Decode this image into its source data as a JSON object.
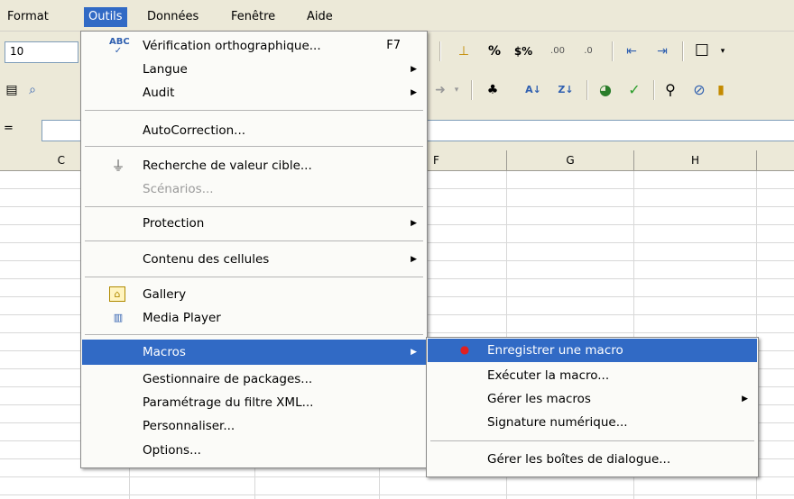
{
  "menubar": {
    "items": [
      {
        "label": "Format"
      },
      {
        "label": "Outils"
      },
      {
        "label": "Données"
      },
      {
        "label": "Fenêtre"
      },
      {
        "label": "Aide"
      }
    ]
  },
  "toolbar": {
    "font_size": "10",
    "formula_prefix": "=",
    "icons": [
      "spellcheck-icon",
      "preview-icon",
      "number-format-icon",
      "percent-icon",
      "currency-icon",
      "add-decimal-icon",
      "delete-decimal-icon",
      "decrease-indent-icon",
      "increase-indent-icon",
      "borders-icon",
      "undo-icon",
      "chart-link-icon",
      "sort-asc-icon",
      "sort-desc-icon",
      "chart-icon",
      "draw-icon",
      "find-icon",
      "navigator-icon"
    ]
  },
  "columns": [
    "C",
    "F",
    "G",
    "H"
  ],
  "outils_menu": {
    "items": [
      {
        "label": "Vérification orthographique...",
        "shortcut": "F7",
        "icon": "spellcheck-icon"
      },
      {
        "label": "Langue",
        "submenu": true
      },
      {
        "label": "Audit",
        "submenu": true
      },
      {
        "label": "AutoCorrection..."
      },
      {
        "label": "Recherche de valeur cible...",
        "icon": "goal-seek-icon"
      },
      {
        "label": "Scénarios...",
        "disabled": true
      },
      {
        "label": "Protection",
        "submenu": true
      },
      {
        "label": "Contenu des cellules",
        "submenu": true
      },
      {
        "label": "Gallery",
        "icon": "gallery-icon"
      },
      {
        "label": "Media Player",
        "icon": "media-player-icon"
      },
      {
        "label": "Macros",
        "submenu": true,
        "highlighted": true
      },
      {
        "label": "Gestionnaire de packages..."
      },
      {
        "label": "Paramétrage du filtre XML..."
      },
      {
        "label": "Personnaliser..."
      },
      {
        "label": "Options..."
      }
    ]
  },
  "macros_menu": {
    "items": [
      {
        "label": "Enregistrer une macro",
        "icon": "record-macro-icon",
        "highlighted": true
      },
      {
        "label": "Exécuter la macro..."
      },
      {
        "label": "Gérer les macros",
        "submenu": true
      },
      {
        "label": "Signature numérique..."
      },
      {
        "label": "Gérer les boîtes de dialogue..."
      }
    ]
  },
  "colors": {
    "highlight": "#316ac5",
    "menu_bg": "#fbfbf8",
    "toolbar_bg": "#ece9d8"
  }
}
